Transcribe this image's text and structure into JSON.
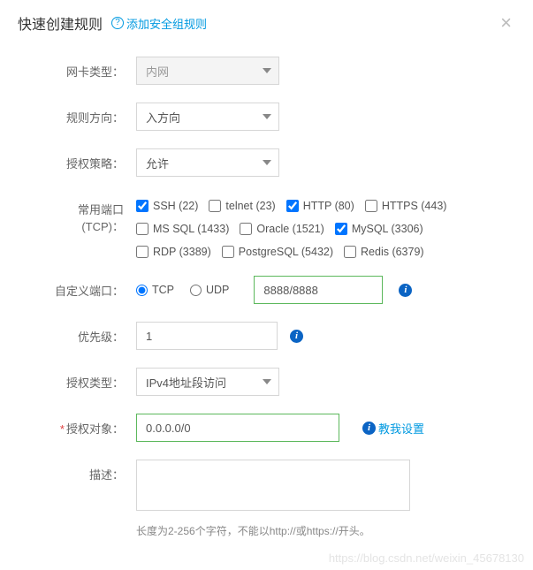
{
  "header": {
    "title": "快速创建规则",
    "help_link": "添加安全组规则"
  },
  "form": {
    "nic_type_label": "网卡类型：",
    "nic_type_value": "内网",
    "direction_label": "规则方向：",
    "direction_value": "入方向",
    "policy_label": "授权策略：",
    "policy_value": "允许",
    "common_port_label": "常用端口(TCP)：",
    "ports": {
      "row1": [
        {
          "label": "SSH (22)",
          "checked": true
        },
        {
          "label": "telnet (23)",
          "checked": false
        },
        {
          "label": "HTTP (80)",
          "checked": true
        },
        {
          "label": "HTTPS (443)",
          "checked": false
        }
      ],
      "row2": [
        {
          "label": "MS SQL (1433)",
          "checked": false
        },
        {
          "label": "Oracle (1521)",
          "checked": false
        },
        {
          "label": "MySQL (3306)",
          "checked": true
        }
      ],
      "row3": [
        {
          "label": "RDP (3389)",
          "checked": false
        },
        {
          "label": "PostgreSQL (5432)",
          "checked": false
        },
        {
          "label": "Redis (6379)",
          "checked": false
        }
      ]
    },
    "custom_port_label": "自定义端口：",
    "protocol": {
      "tcp": "TCP",
      "udp": "UDP",
      "selected": "tcp"
    },
    "custom_port_value": "8888/8888",
    "priority_label": "优先级：",
    "priority_value": "1",
    "auth_type_label": "授权类型：",
    "auth_type_value": "IPv4地址段访问",
    "auth_object_label": "授权对象：",
    "auth_object_value": "0.0.0.0/0",
    "teach_me": "教我设置",
    "desc_label": "描述：",
    "desc_value": "",
    "desc_hint": "长度为2-256个字符，不能以http://或https://开头。"
  },
  "watermark": "https://blog.csdn.net/weixin_45678130"
}
